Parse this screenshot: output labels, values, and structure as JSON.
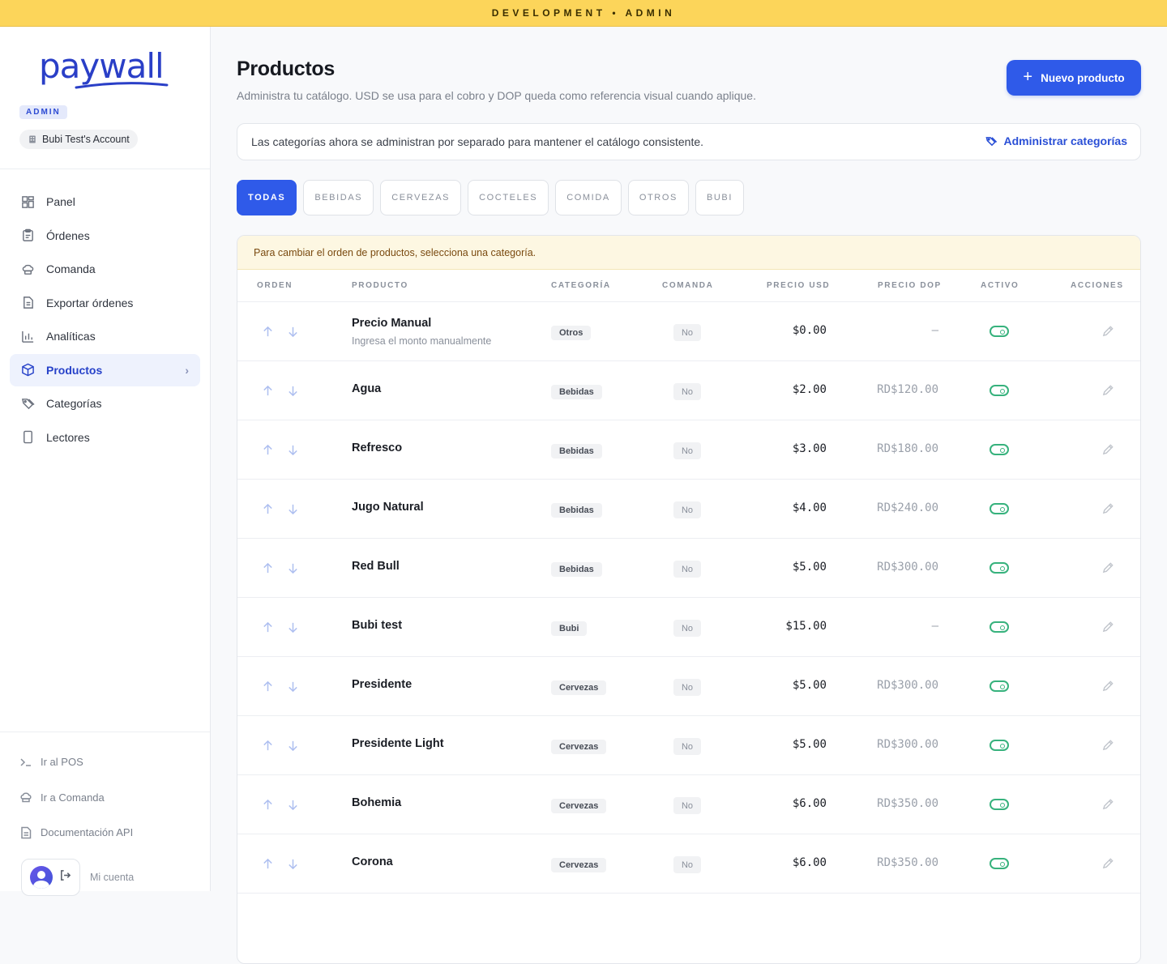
{
  "env_banner": "DEVELOPMENT • ADMIN",
  "sidebar": {
    "logo_text": "paywall",
    "role_badge": "ADMIN",
    "account_name": "Bubi Test's Account",
    "nav": [
      {
        "label": "Panel",
        "icon": "dashboard-icon"
      },
      {
        "label": "Órdenes",
        "icon": "clipboard-icon"
      },
      {
        "label": "Comanda",
        "icon": "chef-hat-icon"
      },
      {
        "label": "Exportar órdenes",
        "icon": "file-export-icon"
      },
      {
        "label": "Analíticas",
        "icon": "bar-chart-icon"
      },
      {
        "label": "Productos",
        "icon": "box-icon",
        "active": true
      },
      {
        "label": "Categorías",
        "icon": "tags-icon"
      },
      {
        "label": "Lectores",
        "icon": "device-icon"
      }
    ],
    "bottom": [
      {
        "label": "Ir al POS",
        "icon": "terminal-icon"
      },
      {
        "label": "Ir a Comanda",
        "icon": "chef-hat-icon"
      },
      {
        "label": "Documentación API",
        "icon": "document-icon"
      }
    ],
    "my_account": "Mi cuenta"
  },
  "header": {
    "title": "Productos",
    "subtitle": "Administra tu catálogo. USD se usa para el cobro y DOP queda como referencia visual cuando aplique.",
    "new_button": "Nuevo producto"
  },
  "info": {
    "text": "Las categorías ahora se administran por separado para mantener el catálogo consistente.",
    "link": "Administrar categorías"
  },
  "tabs": [
    {
      "label": "TODAS",
      "active": true
    },
    {
      "label": "BEBIDAS"
    },
    {
      "label": "CERVEZAS"
    },
    {
      "label": "COCTELES"
    },
    {
      "label": "COMIDA"
    },
    {
      "label": "OTROS"
    },
    {
      "label": "BUBI"
    }
  ],
  "notice": "Para cambiar el orden de productos, selecciona una categoría.",
  "columns": [
    "ORDEN",
    "PRODUCTO",
    "CATEGORÍA",
    "COMANDA",
    "PRECIO USD",
    "PRECIO DOP",
    "ACTIVO",
    "ACCIONES"
  ],
  "products": [
    {
      "name": "Precio Manual",
      "desc": "Ingresa el monto manualmente",
      "category": "Otros",
      "comanda": "No",
      "usd": "$0.00",
      "dop": "—",
      "active": true
    },
    {
      "name": "Agua",
      "desc": "",
      "category": "Bebidas",
      "comanda": "No",
      "usd": "$2.00",
      "dop": "RD$120.00",
      "active": true
    },
    {
      "name": "Refresco",
      "desc": "",
      "category": "Bebidas",
      "comanda": "No",
      "usd": "$3.00",
      "dop": "RD$180.00",
      "active": true
    },
    {
      "name": "Jugo Natural",
      "desc": "",
      "category": "Bebidas",
      "comanda": "No",
      "usd": "$4.00",
      "dop": "RD$240.00",
      "active": true
    },
    {
      "name": "Red Bull",
      "desc": "",
      "category": "Bebidas",
      "comanda": "No",
      "usd": "$5.00",
      "dop": "RD$300.00",
      "active": true
    },
    {
      "name": "Bubi test",
      "desc": "",
      "category": "Bubi",
      "comanda": "No",
      "usd": "$15.00",
      "dop": "—",
      "active": true
    },
    {
      "name": "Presidente",
      "desc": "",
      "category": "Cervezas",
      "comanda": "No",
      "usd": "$5.00",
      "dop": "RD$300.00",
      "active": true
    },
    {
      "name": "Presidente Light",
      "desc": "",
      "category": "Cervezas",
      "comanda": "No",
      "usd": "$5.00",
      "dop": "RD$300.00",
      "active": true
    },
    {
      "name": "Bohemia",
      "desc": "",
      "category": "Cervezas",
      "comanda": "No",
      "usd": "$6.00",
      "dop": "RD$350.00",
      "active": true
    },
    {
      "name": "Corona",
      "desc": "",
      "category": "Cervezas",
      "comanda": "No",
      "usd": "$6.00",
      "dop": "RD$350.00",
      "active": true
    }
  ]
}
